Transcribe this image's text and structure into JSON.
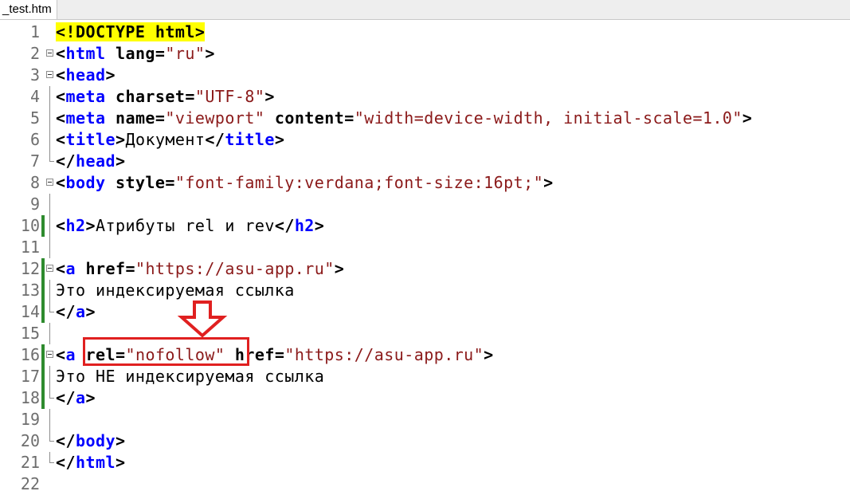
{
  "tab": {
    "title": "_test.htm"
  },
  "lines": [
    {
      "num": "1",
      "doctype": "<!DOCTYPE html>"
    },
    {
      "num": "2",
      "p1": "<",
      "tag": "html",
      "attr": " lang=",
      "val": "\"ru\"",
      "p2": ">"
    },
    {
      "num": "3",
      "p1": "<",
      "tag": "head",
      "p2": ">"
    },
    {
      "num": "4",
      "p1": "<",
      "tag": "meta",
      "attr": " charset=",
      "val": "\"UTF-8\"",
      "p2": ">"
    },
    {
      "num": "5",
      "p1": "<",
      "tag": "meta",
      "attr": " name=",
      "val": "\"viewport\"",
      "attr2": " content=",
      "val2": "\"width=device-width, initial-scale=1.0\"",
      "p2": ">"
    },
    {
      "num": "6",
      "p1": "<",
      "tag": "title",
      "p2": ">",
      "text": "Документ",
      "p3": "</",
      "tag2": "title",
      "p4": ">"
    },
    {
      "num": "7",
      "p1": "</",
      "tag": "head",
      "p2": ">"
    },
    {
      "num": "8",
      "p1": "<",
      "tag": "body",
      "attr": " style=",
      "val": "\"font-family:verdana;font-size:16pt;\"",
      "p2": ">"
    },
    {
      "num": "9"
    },
    {
      "num": "10",
      "p1": "<",
      "tag": "h2",
      "p2": ">",
      "text": "Атрибуты rel и rev",
      "p3": "</",
      "tag2": "h2",
      "p4": ">"
    },
    {
      "num": "11"
    },
    {
      "num": "12",
      "p1": "<",
      "tag": "a",
      "attr": " href=",
      "val": "\"https://asu-app.ru\"",
      "p2": ">"
    },
    {
      "num": "13",
      "text": "Это индексируемая ссылка"
    },
    {
      "num": "14",
      "p1": "</",
      "tag": "a",
      "p2": ">"
    },
    {
      "num": "15"
    },
    {
      "num": "16",
      "p1": "<",
      "tag": "a",
      "attr": " rel=",
      "val": "\"nofollow\"",
      "attr2": " href=",
      "val2": "\"https://asu-app.ru\"",
      "p2": ">"
    },
    {
      "num": "17",
      "text": "Это НЕ индексируемая ссылка"
    },
    {
      "num": "18",
      "p1": "</",
      "tag": "a",
      "p2": ">"
    },
    {
      "num": "19"
    },
    {
      "num": "20",
      "p1": "</",
      "tag": "body",
      "p2": ">"
    },
    {
      "num": "21",
      "p1": "</",
      "tag": "html",
      "p2": ">"
    },
    {
      "num": "22"
    }
  ],
  "colors": {
    "tag": "#0000ff",
    "attribute_value": "#8b1a1a",
    "doctype_highlight": "#ffff00",
    "annotation": "#e02020",
    "change_marker": "#2e8b2e"
  }
}
